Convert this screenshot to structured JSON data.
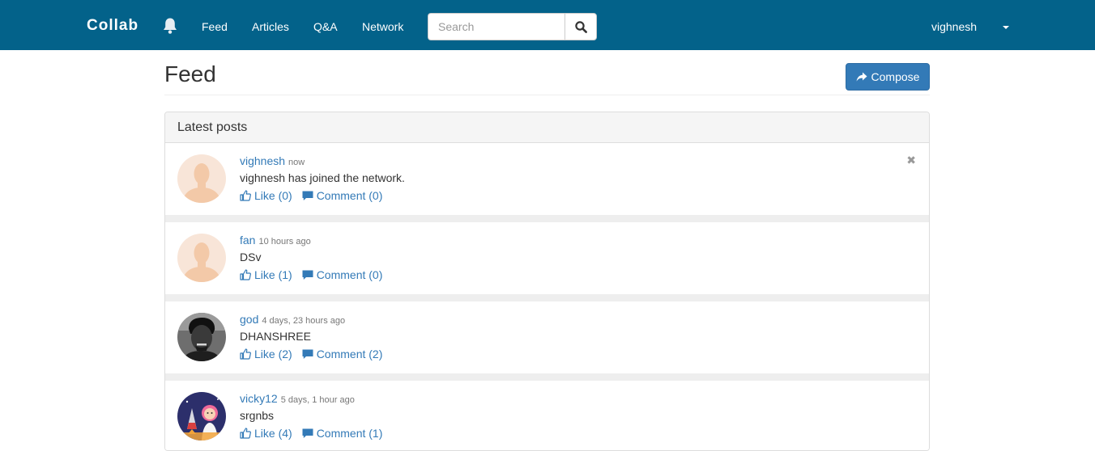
{
  "navbar": {
    "brand": "Collab",
    "links": [
      "Feed",
      "Articles",
      "Q&A",
      "Network"
    ],
    "search_placeholder": "Search",
    "user": "vighnesh",
    "colors": {
      "bar": "#03628a",
      "text": "#ffffff"
    }
  },
  "page": {
    "title": "Feed",
    "compose_label": "Compose"
  },
  "panel": {
    "heading": "Latest posts"
  },
  "posts": [
    {
      "user": "vighnesh",
      "time": "now",
      "text": "vighnesh has joined the network.",
      "like": "Like (0)",
      "comment": "Comment (0)",
      "avatar": "default-avatar",
      "removable": true
    },
    {
      "user": "fan",
      "time": "10 hours ago",
      "text": "DSv",
      "like": "Like (1)",
      "comment": "Comment (0)",
      "avatar": "default-avatar",
      "removable": false
    },
    {
      "user": "god",
      "time": "4 days, 23 hours ago",
      "text": "DHANSHREE",
      "like": "Like (2)",
      "comment": "Comment (2)",
      "avatar": "photo-avatar",
      "removable": false
    },
    {
      "user": "vicky12",
      "time": "5 days, 1 hour ago",
      "text": "srgnbs",
      "like": "Like (4)",
      "comment": "Comment (1)",
      "avatar": "cartoon-avatar",
      "removable": false
    }
  ],
  "colors": {
    "link": "#337ab7",
    "button": "#337ab7",
    "separator": "#eeeeee"
  }
}
